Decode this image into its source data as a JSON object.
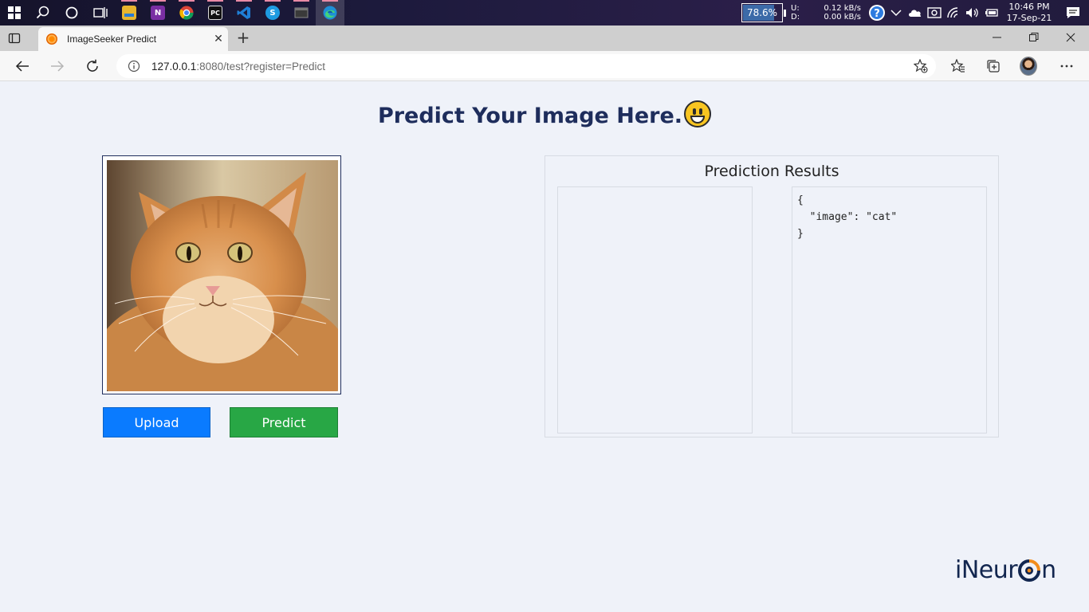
{
  "taskbar": {
    "battery_percent": "78.6%",
    "net_upload_label": "U:",
    "net_download_label": "D:",
    "net_upload": "0.12 kB/s",
    "net_download": "0.00 kB/s",
    "time": "10:46 PM",
    "date": "17-Sep-21",
    "pinned_apps": [
      {
        "name": "file-explorer",
        "color": "#e8b52e"
      },
      {
        "name": "onenote",
        "color": "#7a2fa3",
        "glyph": "N"
      },
      {
        "name": "chrome",
        "color": "#3a8d3a"
      },
      {
        "name": "pycharm",
        "color": "#111111",
        "glyph": "PC"
      },
      {
        "name": "vscode",
        "color": "#1f7fd6"
      },
      {
        "name": "skype",
        "color": "#1e9be1",
        "glyph": "S"
      },
      {
        "name": "terminal",
        "color": "#3a3a3a"
      },
      {
        "name": "edge",
        "color": "#1f8fd6"
      }
    ]
  },
  "browser": {
    "tab_title": "ImageSeeker Predict",
    "url_host": "127.0.0.1",
    "url_rest": ":8080/test?register=Predict"
  },
  "page": {
    "title": "Predict Your Image Here.",
    "upload_label": "Upload",
    "predict_label": "Predict",
    "results_heading": "Prediction Results",
    "json_lines": [
      "{",
      "  \"image\": \"cat\"",
      "}"
    ],
    "logo_prefix": "iNeur",
    "logo_suffix": "n"
  },
  "colors": {
    "accent_blue": "#0a7bff",
    "accent_green": "#28a745",
    "title_navy": "#1e2d5c",
    "logo_orange": "#f28c1b"
  }
}
